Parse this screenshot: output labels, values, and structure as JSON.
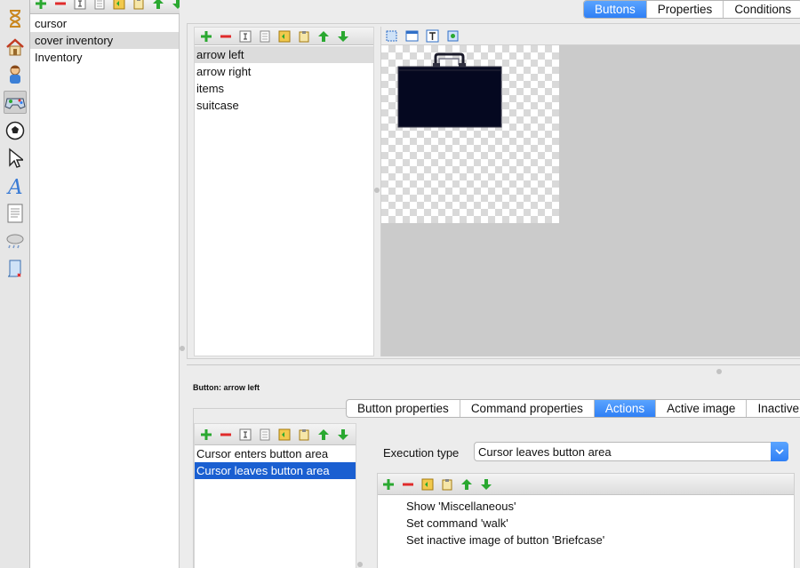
{
  "categories": {
    "items": [
      "cursor",
      "cover inventory",
      "Inventory"
    ],
    "selected": "cover inventory"
  },
  "main_tabs": [
    "Buttons",
    "Properties",
    "Conditions"
  ],
  "main_tab_active": "Buttons",
  "buttons": {
    "items": [
      "arrow left",
      "arrow right",
      "items",
      "suitcase"
    ],
    "selected": "arrow left"
  },
  "button_label": "Button: arrow left",
  "sub_tabs": [
    "Button properties",
    "Command properties",
    "Actions",
    "Active image",
    "Inactive i"
  ],
  "sub_tab_active": "Actions",
  "events": {
    "items": [
      "Cursor enters button area",
      "Cursor leaves button area"
    ],
    "selected": "Cursor leaves button area"
  },
  "execution": {
    "label": "Execution type",
    "value": "Cursor leaves button area"
  },
  "commands": [
    "Show 'Miscellaneous'",
    "Set command 'walk'",
    "Set inactive image of button 'Briefcase'"
  ],
  "colors": {
    "accent": "#2f7ff5",
    "selection": "#1a5fd1",
    "add": "#2aa830",
    "remove": "#e02b2b"
  },
  "icons": {
    "sidebar": [
      "hourglass-icon",
      "house-icon",
      "character-icon",
      "gamepad-icon",
      "ball-icon",
      "cursor-arrow-icon",
      "font-icon",
      "document-icon",
      "weather-icon",
      "script-icon"
    ],
    "toolbar": [
      "add-icon",
      "remove-icon",
      "rename-icon",
      "copy-icon",
      "duplicate-icon",
      "paste-icon",
      "move-up-icon",
      "move-down-icon"
    ]
  }
}
